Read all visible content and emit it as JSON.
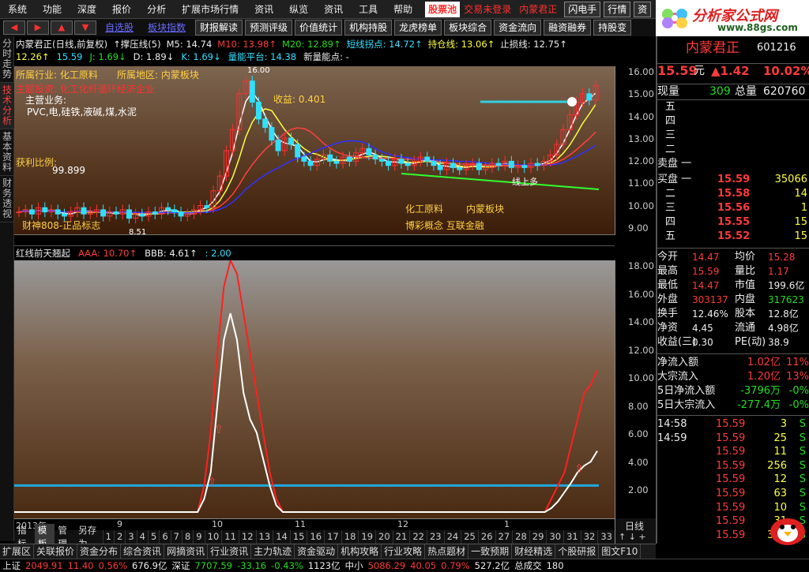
{
  "menu": [
    "系统",
    "功能",
    "深度",
    "报价",
    "分析",
    "扩展市场行情",
    "资讯",
    "纵览",
    "资讯",
    "工具",
    "帮助"
  ],
  "menu_highlight": "股票池",
  "menu_extra": [
    "交易未登录",
    "内蒙君正"
  ],
  "menu_buttons": [
    "闪电手",
    "行情",
    "资"
  ],
  "logo": {
    "title": "分析家公式网",
    "url": "www.88gs.com"
  },
  "toolbar": {
    "links": [
      "自选股",
      "板块指数"
    ],
    "buttons": [
      "财报解读",
      "预测评级",
      "价值统计",
      "机构持股",
      "龙虎榜单",
      "板块综合",
      "资金流向",
      "融资融券",
      "持股变"
    ]
  },
  "left_tabs": [
    "分时走势",
    "技术分析",
    "基本资料",
    "财务透视"
  ],
  "top_info": {
    "line1": [
      {
        "t": "内蒙君正(日线,前复权)",
        "c": "white"
      },
      {
        "t": "↑撑压线(5)",
        "c": "white"
      },
      {
        "t": "M5: 14.74",
        "c": "white"
      },
      {
        "t": "M10: 13.98↑",
        "c": "red"
      },
      {
        "t": "M20: 12.89↑",
        "c": "green"
      },
      {
        "t": "短线拐点: 14.72↑",
        "c": "cyan"
      },
      {
        "t": "持仓线: 13.06↑",
        "c": "yellow"
      },
      {
        "t": "止损线: 12.75↑",
        "c": "white"
      }
    ],
    "line2": [
      {
        "t": "12.26↑",
        "c": "yellow"
      },
      {
        "t": "15.59",
        "c": "cyan"
      },
      {
        "t": "J: 1.69↓",
        "c": "green"
      },
      {
        "t": "D: 1.89↓",
        "c": "white"
      },
      {
        "t": "K: 1.69↓",
        "c": "cyan"
      },
      {
        "t": "量能平台: 14.38",
        "c": "cyan"
      },
      {
        "t": "新量能点: -",
        "c": "white"
      }
    ]
  },
  "chart_top_text": {
    "industry": "所属行业: 化工原料",
    "region": "所属地区: 内蒙板块",
    "theme": "主题投资: 化工化纤循环经济企业",
    "business_label": "主营业务:",
    "business": "PVC,电,硅铁,液碱,煤,水泥",
    "profit_label": "获利比例:",
    "profit": "99.899",
    "income": "收益: 0.401",
    "tag1": "化工原料",
    "tag2": "内蒙板块",
    "concept": "博彩概念 互联金融",
    "wealth": "财神808-正品标志",
    "low": "8.51",
    "high": "16.00",
    "on_line": "线上多"
  },
  "bottom_info": [
    {
      "t": "红线前天翘起",
      "c": "white"
    },
    {
      "t": "AAA: 10.70↑",
      "c": "red"
    },
    {
      "t": "BBB: 4.61↑",
      "c": "white"
    },
    {
      "t": ": 2.00",
      "c": "cyan"
    }
  ],
  "axis_top": [
    "16.00",
    "15.00",
    "14.00",
    "13.00",
    "12.00",
    "11.00",
    "10.00",
    "9.00"
  ],
  "axis_bottom": [
    "18.00",
    "16.00",
    "14.00",
    "12.00",
    "10.00",
    "8.00",
    "6.00",
    "4.00",
    "2.00"
  ],
  "time_axis": [
    "2013年",
    "9",
    "10",
    "11",
    "12",
    "1"
  ],
  "ind_tabs": [
    "指标",
    "模板",
    "管理",
    "另存为"
  ],
  "ind_nums": [
    "1",
    "2",
    "3",
    "4",
    "5",
    "6",
    "7",
    "8",
    "9",
    "10",
    "11",
    "12",
    "13",
    "14",
    "15",
    "16",
    "17",
    "18",
    "19",
    "20",
    "21",
    "22",
    "23",
    "24",
    "25",
    "26",
    "27",
    "28",
    "29",
    "30",
    "31",
    "32",
    "33"
  ],
  "period": "日线",
  "bottom_tabs": [
    "扩展区",
    "关联报价",
    "资金分布",
    "综合资讯",
    "网摘资讯",
    "行业资讯",
    "主力轨迹",
    "资金驱动",
    "机构攻略",
    "行业攻略",
    "热点题材",
    "一致预期",
    "财经精选",
    "个股研报",
    "图文F10"
  ],
  "status": [
    {
      "t": "上证",
      "c": "white"
    },
    {
      "t": "2049.91",
      "c": "red"
    },
    {
      "t": "11.40",
      "c": "red"
    },
    {
      "t": "0.56%",
      "c": "red"
    },
    {
      "t": "676.9亿",
      "c": "white"
    },
    {
      "t": "深证",
      "c": "white"
    },
    {
      "t": "7707.59",
      "c": "green"
    },
    {
      "t": "-33.16",
      "c": "green"
    },
    {
      "t": "-0.43%",
      "c": "green"
    },
    {
      "t": "1123亿",
      "c": "white"
    },
    {
      "t": "中小",
      "c": "white"
    },
    {
      "t": "5086.29",
      "c": "red"
    },
    {
      "t": "40.05",
      "c": "red"
    },
    {
      "t": "0.79%",
      "c": "red"
    },
    {
      "t": "527.2亿",
      "c": "white"
    },
    {
      "t": "总成交",
      "c": "white"
    },
    {
      "t": "180",
      "c": "white"
    }
  ],
  "stock": {
    "name": "内蒙君正",
    "code": "601216",
    "price": "15.59",
    "unit": "元",
    "change": "▲1.42",
    "pct": "10.02%"
  },
  "volume_now": {
    "label": "现量",
    "val": "309",
    "label2": "总量",
    "val2": "620760"
  },
  "sell": [
    {
      "l": "五",
      "p": "",
      "v": ""
    },
    {
      "l": "四",
      "p": "",
      "v": ""
    },
    {
      "l": "三",
      "p": "",
      "v": ""
    },
    {
      "l": "二",
      "p": "",
      "v": ""
    },
    {
      "l": "卖盘 一",
      "p": "",
      "v": ""
    }
  ],
  "buy": [
    {
      "l": "买盘 一",
      "p": "15.59",
      "v": "35066"
    },
    {
      "l": "二",
      "p": "15.58",
      "v": "14"
    },
    {
      "l": "三",
      "p": "15.56",
      "v": "1"
    },
    {
      "l": "四",
      "p": "15.55",
      "v": "15"
    },
    {
      "l": "五",
      "p": "15.52",
      "v": "15"
    }
  ],
  "stats": [
    [
      {
        "t": "今开",
        "c": "white"
      },
      {
        "t": "14.47",
        "c": "red"
      },
      {
        "t": "均价",
        "c": "white"
      },
      {
        "t": "15.28",
        "c": "red"
      }
    ],
    [
      {
        "t": "最高",
        "c": "white"
      },
      {
        "t": "15.59",
        "c": "red"
      },
      {
        "t": "量比",
        "c": "white"
      },
      {
        "t": "1.17",
        "c": "red"
      }
    ],
    [
      {
        "t": "最低",
        "c": "white"
      },
      {
        "t": "14.47",
        "c": "red"
      },
      {
        "t": "市值",
        "c": "white"
      },
      {
        "t": "199.6亿",
        "c": "white"
      }
    ],
    [
      {
        "t": "外盘",
        "c": "white"
      },
      {
        "t": "303137",
        "c": "red"
      },
      {
        "t": "内盘",
        "c": "white"
      },
      {
        "t": "317623",
        "c": "green"
      }
    ],
    [
      {
        "t": "换手",
        "c": "white"
      },
      {
        "t": "12.46%",
        "c": "white"
      },
      {
        "t": "股本",
        "c": "white"
      },
      {
        "t": "12.8亿",
        "c": "white"
      }
    ],
    [
      {
        "t": "净资",
        "c": "white"
      },
      {
        "t": "4.45",
        "c": "white"
      },
      {
        "t": "流通",
        "c": "white"
      },
      {
        "t": "4.98亿",
        "c": "white"
      }
    ],
    [
      {
        "t": "收益(三)",
        "c": "white"
      },
      {
        "t": "0.30",
        "c": "white"
      },
      {
        "t": "PE(动)",
        "c": "white"
      },
      {
        "t": "38.9",
        "c": "white"
      }
    ]
  ],
  "flows": [
    {
      "l": "净流入额",
      "v": "1.02亿",
      "p": "11%",
      "c": "red"
    },
    {
      "l": "大宗流入",
      "v": "1.20亿",
      "p": "13%",
      "c": "red"
    },
    {
      "l": "5日净流入额",
      "v": "-3796万",
      "p": "-0%",
      "c": "green"
    },
    {
      "l": "5日大宗流入",
      "v": "-277.4万",
      "p": "-0%",
      "c": "green"
    }
  ],
  "ticks": [
    {
      "t": "14:58",
      "p": "15.59",
      "v": "3",
      "s": "S"
    },
    {
      "t": "14:59",
      "p": "15.59",
      "v": "25",
      "s": "S"
    },
    {
      "t": "",
      "p": "15.59",
      "v": "11",
      "s": "S"
    },
    {
      "t": "",
      "p": "15.59",
      "v": "256",
      "s": "S"
    },
    {
      "t": "",
      "p": "15.59",
      "v": "12",
      "s": "S"
    },
    {
      "t": "",
      "p": "15.59",
      "v": "63",
      "s": "S"
    },
    {
      "t": "",
      "p": "15.59",
      "v": "10",
      "s": "S"
    },
    {
      "t": "",
      "p": "15.59",
      "v": "31",
      "s": "S"
    },
    {
      "t": "",
      "p": "15.59",
      "v": "309",
      "s": "S"
    }
  ],
  "chart_data": {
    "type": "line",
    "ylim_top": [
      8.5,
      16.5
    ],
    "ylim_bottom": [
      0,
      19
    ],
    "candles_close": [
      9.6,
      9.7,
      9.5,
      9.8,
      9.6,
      9.7,
      9.5,
      9.4,
      9.6,
      9.8,
      9.5,
      9.6,
      9.7,
      9.4,
      9.6,
      9.5,
      9.7,
      9.3,
      9.5,
      9.4,
      9.6,
      9.5,
      9.8,
      9.7,
      9.6,
      9.4,
      9.5,
      9.7,
      9.9,
      9.8,
      10.6,
      11.3,
      12.5,
      13.5,
      15.2,
      15.8,
      14.8,
      14.0,
      13.6,
      13.0,
      12.5,
      13.1,
      12.8,
      12.2,
      12.0,
      11.8,
      12.1,
      12.3,
      12.0,
      11.9,
      12.2,
      12.0,
      12.4,
      12.6,
      12.3,
      12.1,
      12.0,
      11.8,
      12.1,
      11.9,
      11.8,
      12.0,
      12.2,
      12.0,
      11.8,
      11.6,
      11.9,
      11.7,
      11.6,
      11.8,
      11.9,
      11.6,
      11.7,
      11.9,
      11.8,
      12.0,
      11.7,
      11.8,
      11.7,
      11.9,
      11.8,
      12.0,
      12.3,
      12.8,
      13.5,
      14.2,
      14.8,
      15.2,
      14.9,
      15.59
    ],
    "series": [
      {
        "name": "AAA",
        "values": [
          0,
          0,
          0,
          0,
          0,
          0,
          0,
          0,
          0,
          0,
          0,
          0,
          0,
          0,
          0,
          0,
          0,
          0,
          0,
          0,
          0,
          0,
          0,
          0,
          0,
          0,
          0,
          0,
          0,
          2,
          6,
          12,
          17,
          19,
          18,
          15,
          12,
          9,
          6,
          3,
          1,
          0,
          0,
          0,
          0,
          0,
          0,
          0,
          0,
          0,
          0,
          0,
          0,
          0,
          0,
          0,
          0,
          0,
          0,
          0,
          0,
          0,
          0,
          0,
          0,
          0,
          0,
          0,
          0,
          0,
          0,
          0,
          0,
          0,
          0,
          0,
          0,
          0,
          0,
          0,
          0,
          0,
          1,
          2,
          3,
          5,
          7,
          9,
          9.6,
          10.7
        ]
      },
      {
        "name": "BBB",
        "values": [
          0,
          0,
          0,
          0,
          0,
          0,
          0,
          0,
          0,
          0,
          0,
          0,
          0,
          0,
          0,
          0,
          0,
          0,
          0,
          0,
          0,
          0,
          0,
          0,
          0,
          0,
          0,
          0,
          0,
          1,
          3,
          8,
          13,
          15,
          13,
          9,
          7,
          6,
          4,
          2,
          0.5,
          0,
          0,
          0,
          0,
          0,
          0,
          0,
          0,
          0,
          0,
          0,
          0,
          0,
          0,
          0,
          0,
          0,
          0,
          0,
          0,
          0,
          0,
          0,
          0,
          0,
          0,
          0,
          0,
          0,
          0,
          0,
          0,
          0,
          0,
          0,
          0,
          0,
          0,
          0,
          0,
          0,
          0.3,
          0.8,
          1.5,
          2.2,
          3.0,
          3.5,
          3.8,
          4.61
        ]
      },
      {
        "name": "",
        "values": [
          2,
          2
        ]
      }
    ]
  }
}
